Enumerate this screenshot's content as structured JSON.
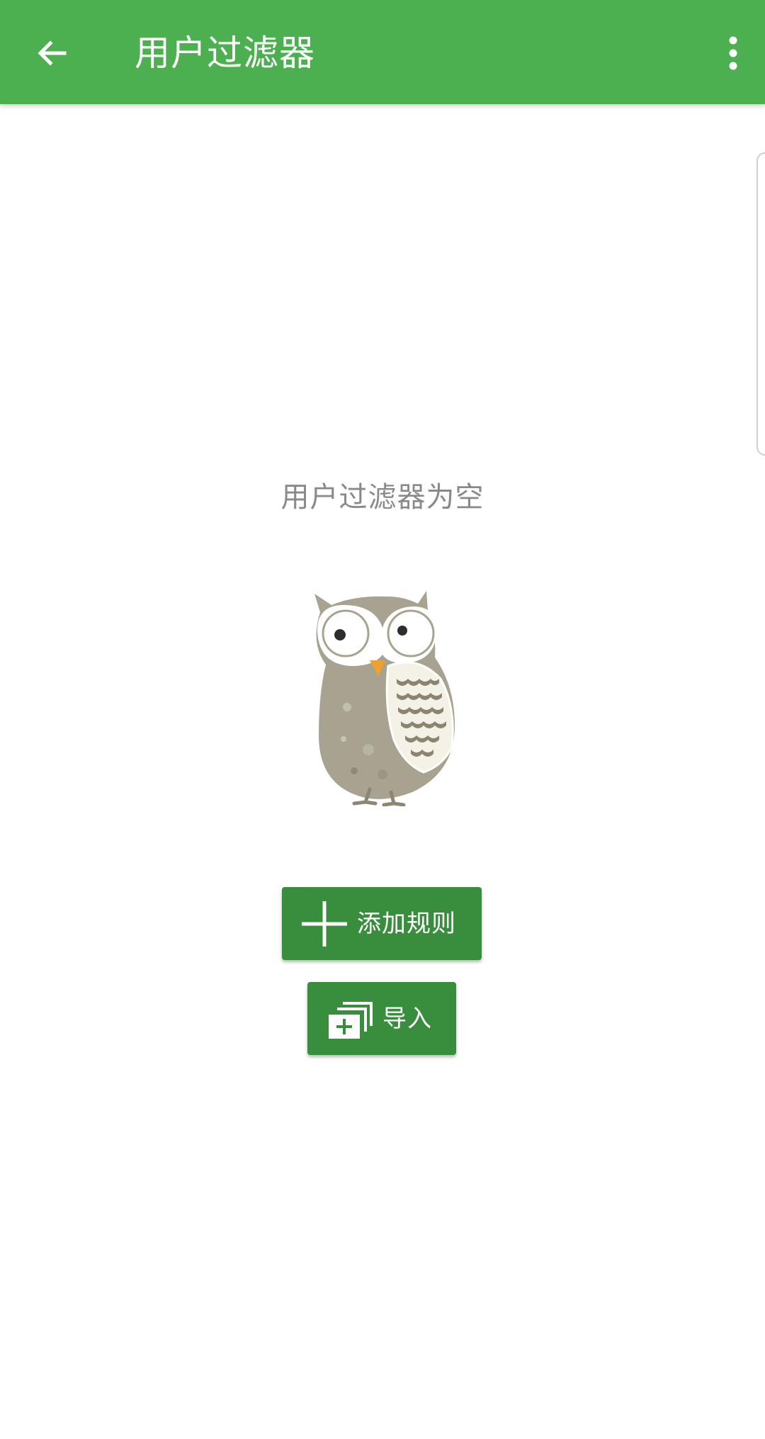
{
  "toolbar": {
    "title": "用户过滤器",
    "back_icon": "arrow-left-icon",
    "menu_icon": "more-vert-icon",
    "color": "#4caf50"
  },
  "empty_state": {
    "message": "用户过滤器为空",
    "illustration": "owl-illustration"
  },
  "actions": {
    "add_rule_label": "添加规则",
    "add_rule_icon": "plus-icon",
    "import_label": "导入",
    "import_icon": "import-stack-icon",
    "button_color": "#388e3c"
  }
}
